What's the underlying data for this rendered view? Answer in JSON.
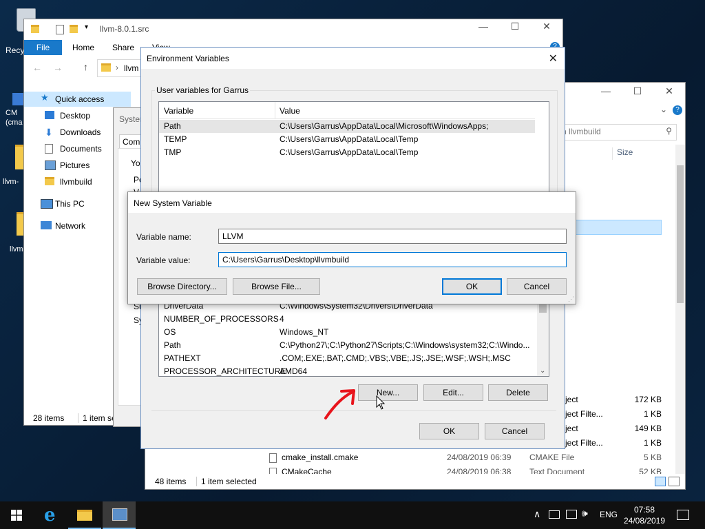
{
  "desktop": {
    "icons": [
      {
        "label": "Recy"
      },
      {
        "label": "CM\n(cma"
      },
      {
        "label": "llvm-"
      },
      {
        "label": "llvm"
      }
    ]
  },
  "explorer_back": {
    "title": "llvm-8.0.1.src",
    "ribbon": {
      "file": "File",
      "home": "Home",
      "share": "Share",
      "view": "View"
    },
    "address": "llvm",
    "nav": {
      "quick_access": "Quick access",
      "items": [
        "Desktop",
        "Downloads",
        "Documents",
        "Pictures",
        "llvmbuild"
      ],
      "this_pc": "This PC",
      "network": "Network"
    },
    "status": {
      "items": "28 items",
      "selected": "1 item sel"
    }
  },
  "system_props": {
    "title_fragment": "Syster",
    "tab_fragment": "Comp",
    "text_fragments": [
      "You",
      "Pe",
      "V",
      "Su",
      "Sy"
    ]
  },
  "explorer_right": {
    "search_placeholder": "h llvmbuild",
    "col_size": "Size",
    "rows": [
      {
        "name": "",
        "date": "",
        "type": "ject",
        "size": "172 KB"
      },
      {
        "name": "",
        "date": "",
        "type": "ject Filte...",
        "size": "1 KB"
      },
      {
        "name": "",
        "date": "",
        "type": "ject",
        "size": "149 KB"
      },
      {
        "name": "",
        "date": "",
        "type": "ject Filte...",
        "size": "1 KB"
      },
      {
        "name": "cmake_install.cmake",
        "date": "24/08/2019 06:39",
        "type": "CMAKE File",
        "size": "5 KB"
      },
      {
        "name": "CMakeCache",
        "date": "24/08/2019 06:38",
        "type": "Text Document",
        "size": "52 KB"
      }
    ],
    "status": {
      "items": "48 items",
      "selected": "1 item selected"
    }
  },
  "env_dialog": {
    "title": "Environment Variables",
    "user_group": "User variables for Garrus",
    "col_variable": "Variable",
    "col_value": "Value",
    "user_vars": [
      {
        "name": "Path",
        "value": "C:\\Users\\Garrus\\AppData\\Local\\Microsoft\\WindowsApps;"
      },
      {
        "name": "TEMP",
        "value": "C:\\Users\\Garrus\\AppData\\Local\\Temp"
      },
      {
        "name": "TMP",
        "value": "C:\\Users\\Garrus\\AppData\\Local\\Temp"
      }
    ],
    "system_vars": [
      {
        "name": "DriverData",
        "value": "C:\\Windows\\System32\\Drivers\\DriverData"
      },
      {
        "name": "NUMBER_OF_PROCESSORS",
        "value": "4"
      },
      {
        "name": "OS",
        "value": "Windows_NT"
      },
      {
        "name": "Path",
        "value": "C:\\Python27\\;C:\\Python27\\Scripts;C:\\Windows\\system32;C:\\Windo..."
      },
      {
        "name": "PATHEXT",
        "value": ".COM;.EXE;.BAT;.CMD;.VBS;.VBE;.JS;.JSE;.WSF;.WSH;.MSC"
      },
      {
        "name": "PROCESSOR_ARCHITECTURE",
        "value": "AMD64"
      }
    ],
    "buttons": {
      "new": "New...",
      "edit": "Edit...",
      "delete": "Delete",
      "ok": "OK",
      "cancel": "Cancel"
    }
  },
  "new_var_dialog": {
    "title": "New System Variable",
    "name_label": "Variable name:",
    "name_value": "LLVM",
    "value_label": "Variable value:",
    "value_value": "C:\\Users\\Garrus\\Desktop\\llvmbuild",
    "buttons": {
      "browse_dir": "Browse Directory...",
      "browse_file": "Browse File...",
      "ok": "OK",
      "cancel": "Cancel"
    }
  },
  "taskbar": {
    "lang": "ENG",
    "time": "07:58",
    "date": "24/08/2019"
  },
  "colors": {
    "accent": "#0078d7",
    "taskbar": "#101010",
    "annotation": "#e8141c"
  }
}
